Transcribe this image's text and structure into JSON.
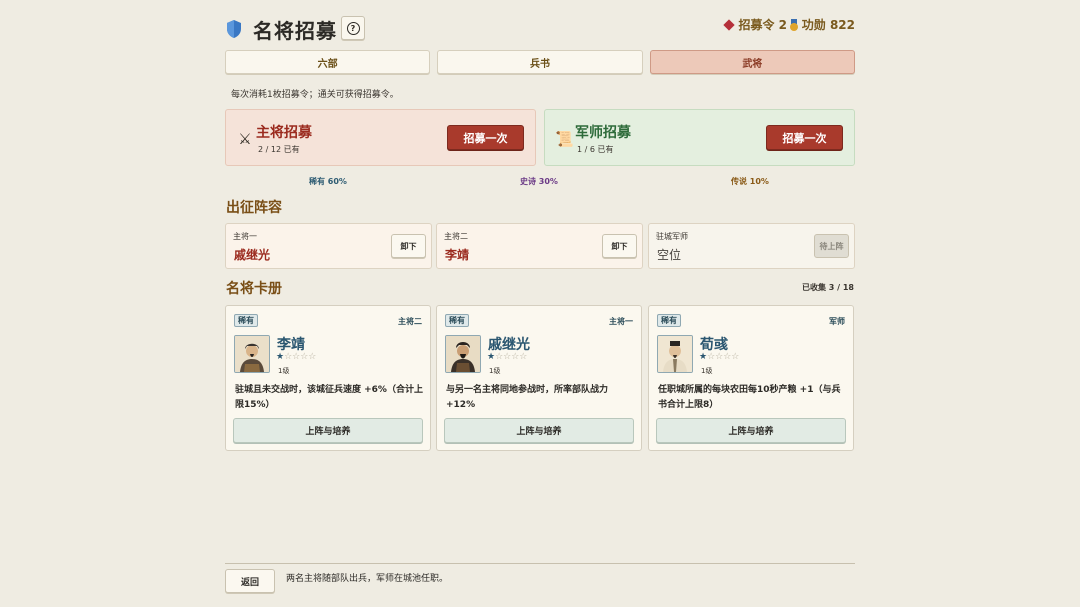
{
  "header": {
    "title": "名将招募",
    "help_icon": "question-icon",
    "help_label": "?",
    "token_label": "招募令 2",
    "merit_label": "功勋 822"
  },
  "tabs": [
    {
      "label": "六部",
      "active": false
    },
    {
      "label": "兵书",
      "active": false
    },
    {
      "label": "武将",
      "active": true
    }
  ],
  "note": "每次消耗1枚招募令；通关可获得招募令。",
  "recruit": {
    "general": {
      "icon": "crossed-swords-icon",
      "title": "主将招募",
      "count": "2 / 12 已有",
      "button": "招募一次"
    },
    "advisor": {
      "icon": "scroll-icon",
      "title": "军师招募",
      "count": "1 / 6 已有",
      "button": "招募一次"
    }
  },
  "rates": [
    "稀有 60%",
    "史诗 30%",
    "传说 10%"
  ],
  "lineup": {
    "title": "出征阵容",
    "slots": [
      {
        "label": "主将一",
        "name": "戚继光",
        "button": "卸下"
      },
      {
        "label": "主将二",
        "name": "李靖",
        "button": "卸下"
      },
      {
        "label": "驻城军师",
        "name": "空位",
        "button": "待上阵"
      }
    ]
  },
  "cards_section": {
    "title": "名将卡册",
    "collected": "已收集 3 / 18",
    "cards": [
      {
        "rarity": "稀有",
        "role": "主将二",
        "name": "李靖",
        "stars": "★☆☆☆☆",
        "level": "1级",
        "desc": "驻城且未交战时，该城征兵速度 +6%（合计上限15%）",
        "button": "上阵与培养"
      },
      {
        "rarity": "稀有",
        "role": "主将一",
        "name": "戚继光",
        "stars": "★☆☆☆☆",
        "level": "1级",
        "desc": "与另一名主将同地参战时，所率部队战力 +12%",
        "button": "上阵与培养"
      },
      {
        "rarity": "稀有",
        "role": "军师",
        "name": "荀彧",
        "stars": "★☆☆☆☆",
        "level": "1级",
        "desc": "任职城所属的每块农田每10秒产粮 +1（与兵书合计上限8）",
        "button": "上阵与培养"
      }
    ]
  },
  "footer": {
    "back": "返回",
    "note": "两名主将随部队出兵，军师在城池任职。"
  },
  "colors": {
    "accent_red": "#a93a2c",
    "rarity_blue": "#2a5670",
    "background": "#efece2"
  }
}
